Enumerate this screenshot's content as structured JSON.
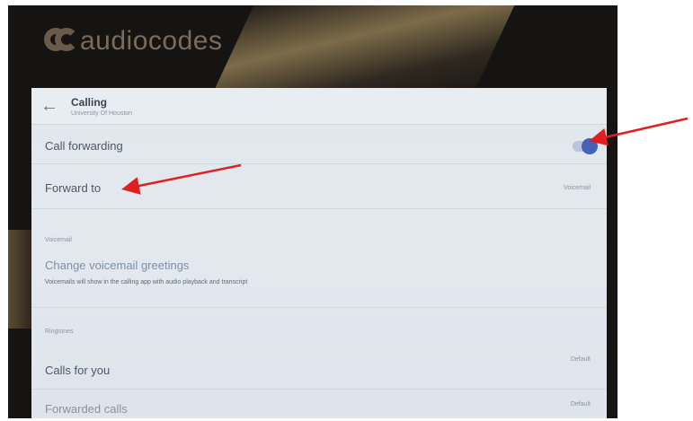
{
  "brand": {
    "logo_text": "audiocodes"
  },
  "header": {
    "back_icon": "arrow-left-icon",
    "title": "Calling",
    "subtitle": "University Of Houston"
  },
  "call_forwarding": {
    "label": "Call forwarding",
    "enabled": true,
    "toggle_color": "#4562b8"
  },
  "forward_to": {
    "label": "Forward to",
    "value": "Voicemail"
  },
  "voicemail_section": {
    "heading": "Voicemail",
    "change_greetings": "Change voicemail greetings",
    "description": "Voicemails will show in the calling app with audio playback and transcript"
  },
  "ringtones_section": {
    "heading": "Ringtones",
    "calls_for_you": {
      "label": "Calls for you",
      "value": "Default"
    },
    "forwarded_calls": {
      "label": "Forwarded calls",
      "value": "Default"
    }
  },
  "annotations": {
    "arrow_color": "#e02020"
  }
}
